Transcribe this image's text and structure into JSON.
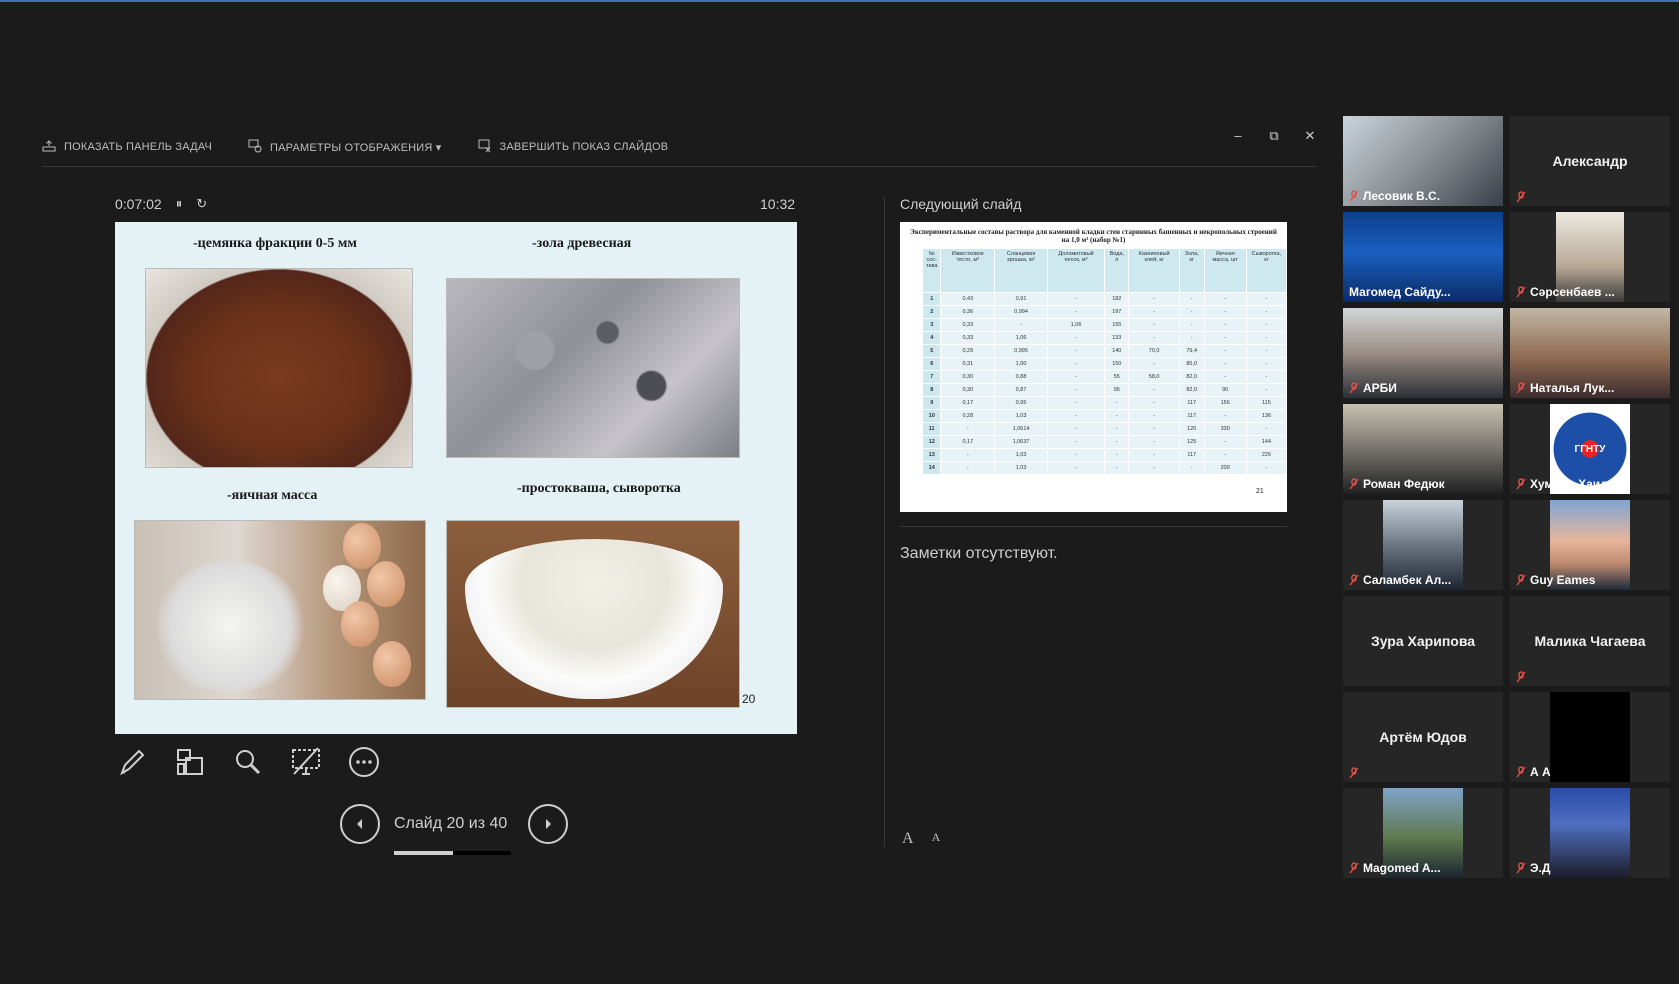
{
  "toolbar": {
    "show_taskbar": "ПОКАЗАТЬ ПАНЕЛЬ ЗАДАЧ",
    "display_settings": "ПАРАМЕТРЫ ОТОБРАЖЕНИЯ ▾",
    "end_show": "ЗАВЕРШИТЬ ПОКАЗ СЛАЙДОВ"
  },
  "window": {
    "minimize": "–",
    "restore": "⧉",
    "close": "✕"
  },
  "timer": {
    "elapsed": "0:07:02",
    "pause": "⏸",
    "reset": "↻",
    "clock": "10:32"
  },
  "current_slide": {
    "captions": [
      "-цемянка фракции 0-5 мм",
      "-зола древесная",
      "-яичная масса",
      "-простокваша, сыворотка"
    ],
    "number": "20"
  },
  "nav": {
    "counter": "Слайд 20 из 40",
    "progress": 0.5
  },
  "next_slide": {
    "label": "Следующий слайд",
    "title": "Экспериментальные составы раствора для каменной кладки стен старинных башенных и некропольных строений на 1,0 м³ (набор №1)",
    "headers": [
      "№ сос-тава",
      "Известковое тесто, м³",
      "Сланцевая крошка, м³",
      "Доломитовый песок, м³",
      "Вода, л",
      "Казеиновый клей, кг",
      "Зола, кг",
      "Яичная масса, шт",
      "Сыворотка, кг"
    ],
    "rows": [
      [
        "1",
        "0,43",
        "0,91",
        "-",
        "182",
        "-",
        "-",
        "-",
        "-"
      ],
      [
        "2",
        "0,36",
        "0,994",
        "-",
        "197",
        "-",
        "-",
        "-",
        "-"
      ],
      [
        "3",
        "0,33",
        "-",
        "1,06",
        "155",
        "-",
        "-",
        "-",
        "-"
      ],
      [
        "4",
        "0,33",
        "1,06",
        "-",
        "133",
        "-",
        "-",
        "-",
        "-"
      ],
      [
        "5",
        "0,29",
        "0,995",
        "-",
        "140",
        "70,0",
        "79,4",
        "-",
        "-"
      ],
      [
        "6",
        "0,31",
        "1,00",
        "-",
        "150",
        "-",
        "85,0",
        "-",
        "-"
      ],
      [
        "7",
        "0,30",
        "0,88",
        "-",
        "55",
        "58,0",
        "82,0",
        "-",
        "-"
      ],
      [
        "8",
        "0,30",
        "0,87",
        "-",
        "95",
        "-",
        "82,0",
        "90",
        "-"
      ],
      [
        "9",
        "0,17",
        "0,95",
        "-",
        "-",
        "-",
        "117",
        "156",
        "115"
      ],
      [
        "10",
        "0,28",
        "1,03",
        "-",
        "-",
        "-",
        "117",
        "-",
        "136"
      ],
      [
        "11",
        "-",
        "1,0614",
        "-",
        "-",
        "-",
        "120",
        "330",
        "-"
      ],
      [
        "12",
        "0,17",
        "1,0637",
        "-",
        "-",
        "-",
        "125",
        "-",
        "144"
      ],
      [
        "13",
        "-",
        "1,03",
        "-",
        "-",
        "-",
        "117",
        "-",
        "226"
      ],
      [
        "14",
        "-",
        "1,03",
        "-",
        "-",
        "-",
        "-",
        "200",
        "-"
      ]
    ],
    "number": "21"
  },
  "notes": {
    "text": "Заметки отсутствуют.",
    "font_up": "A",
    "font_down": "A"
  },
  "participants": [
    {
      "name": "Лесовик В.С.",
      "video": true,
      "muted": true
    },
    {
      "name": "Александр",
      "video": false,
      "muted": true
    },
    {
      "name": "Магомед Сайду...",
      "video": true,
      "muted": false,
      "active": true
    },
    {
      "name": "Сәрсенбаев ...",
      "video": true,
      "muted": true
    },
    {
      "name": "АРБИ",
      "video": true,
      "muted": true
    },
    {
      "name": "Наталья Лук...",
      "video": true,
      "muted": true
    },
    {
      "name": "Роман Федюк",
      "video": true,
      "muted": true
    },
    {
      "name": "Хумайд Хаид...",
      "video": true,
      "muted": true
    },
    {
      "name": "Саламбек Ал...",
      "video": true,
      "muted": true
    },
    {
      "name": "Guy Eames",
      "video": true,
      "muted": true
    },
    {
      "name": "Зура Харипова",
      "video": false,
      "muted": false
    },
    {
      "name": "Малика Чагаева",
      "video": false,
      "muted": true
    },
    {
      "name": "Артём Юдов",
      "video": false,
      "muted": true
    },
    {
      "name": "А А",
      "video": true,
      "muted": true
    },
    {
      "name": "Magomed A...",
      "video": true,
      "muted": true
    },
    {
      "name": "Э.Д",
      "video": true,
      "muted": true
    }
  ],
  "logo_text": "ГГНТУ",
  "colors": {
    "accent": "#3d6fb6",
    "active_speaker": "#e6d845",
    "mute": "#e0524a"
  }
}
